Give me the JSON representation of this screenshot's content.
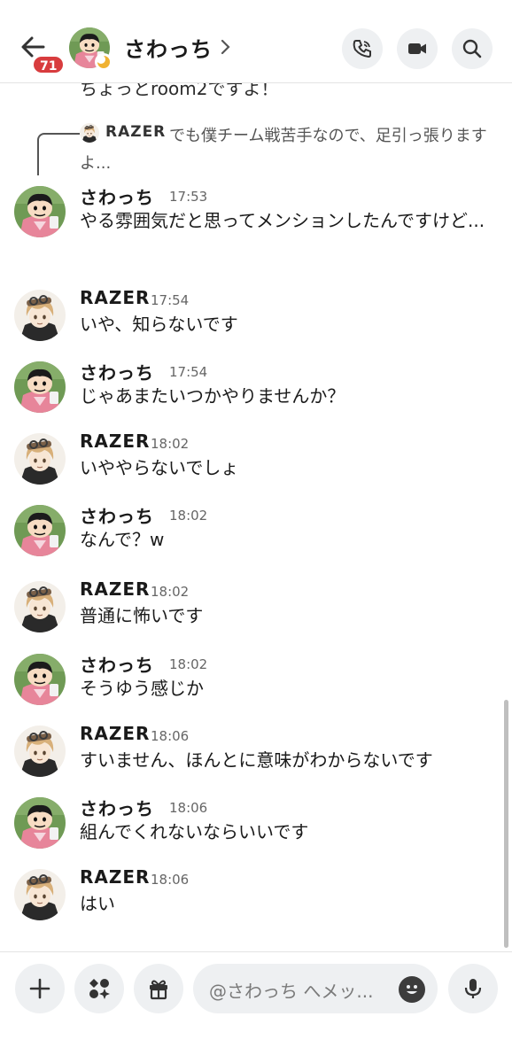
{
  "header": {
    "title": "さわっち",
    "unread_badge": "71"
  },
  "partial_message": "ちょっとroom2ですよ！",
  "reply": {
    "author": "RAZER",
    "text": "でも僕チーム戦苦手なので、足引っ張りますよ..."
  },
  "messages": [
    {
      "author": "さわっち",
      "time": "17:53",
      "text": "やる雰囲気だと思ってメンションしたんですけど..."
    },
    {
      "author": "RAZER",
      "time": "17:54",
      "text": "いや、知らないです"
    },
    {
      "author": "さわっち",
      "time": "17:54",
      "text": "じゃあまたいつかやりませんか？"
    },
    {
      "author": "RAZER",
      "time": "18:02",
      "text": "いややらないでしょ"
    },
    {
      "author": "さわっち",
      "time": "18:02",
      "text": "なんで？w"
    },
    {
      "author": "RAZER",
      "time": "18:02",
      "text": "普通に怖いです"
    },
    {
      "author": "さわっち",
      "time": "18:02",
      "text": "そうゆう感じか"
    },
    {
      "author": "RAZER",
      "time": "18:06",
      "text": "すいません、ほんとに意味がわからないです"
    },
    {
      "author": "さわっち",
      "time": "18:06",
      "text": "組んでくれないならいいです"
    },
    {
      "author": "RAZER",
      "time": "18:06",
      "text": "はい"
    }
  ],
  "composer": {
    "placeholder": "@さわっち へメッ..."
  },
  "icons": {
    "back": "arrow-left-icon",
    "call": "phone-call-icon",
    "video": "video-camera-icon",
    "search": "search-icon",
    "add": "plus-icon",
    "apps": "apps-icon",
    "gift": "gift-icon",
    "emoji": "emoji-icon",
    "mic": "microphone-icon"
  },
  "colors": {
    "badge": "#d83c3e",
    "button_bg": "#eef0f2"
  }
}
